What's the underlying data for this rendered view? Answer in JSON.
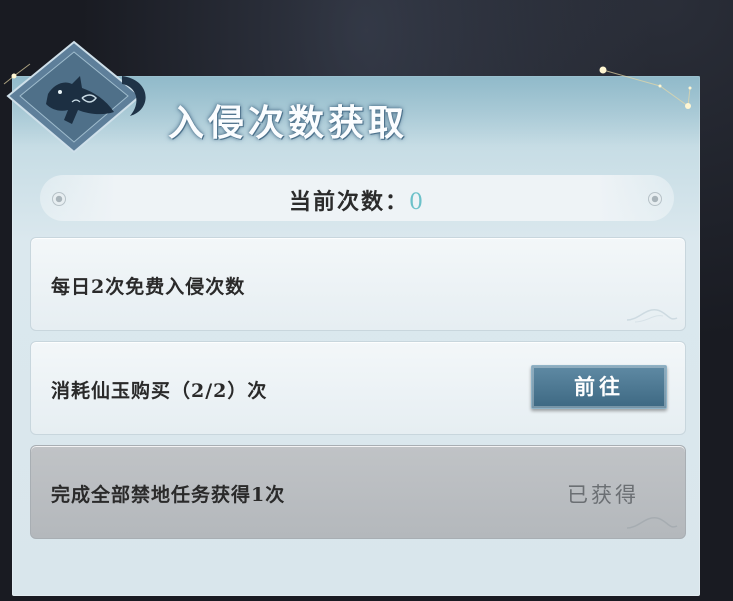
{
  "dialog": {
    "title": "入侵次数获取",
    "count_label": "当前次数：",
    "count_value": "0"
  },
  "tasks": [
    {
      "label": "每日2次免费入侵次数"
    },
    {
      "label": "消耗仙玉购买（2/2）次",
      "button_label": "前往"
    },
    {
      "label": "完成全部禁地任务获得1次",
      "status": "已获得"
    }
  ],
  "icons": [
    "fox-spirit-emblem-icon",
    "constellation-icon",
    "cloud-curl-icon"
  ],
  "colors": {
    "count_value": "#6cc1c9",
    "go_button": "#4a7590",
    "panel": "#d9e6ec",
    "completed_row": "#b9bdc1"
  }
}
